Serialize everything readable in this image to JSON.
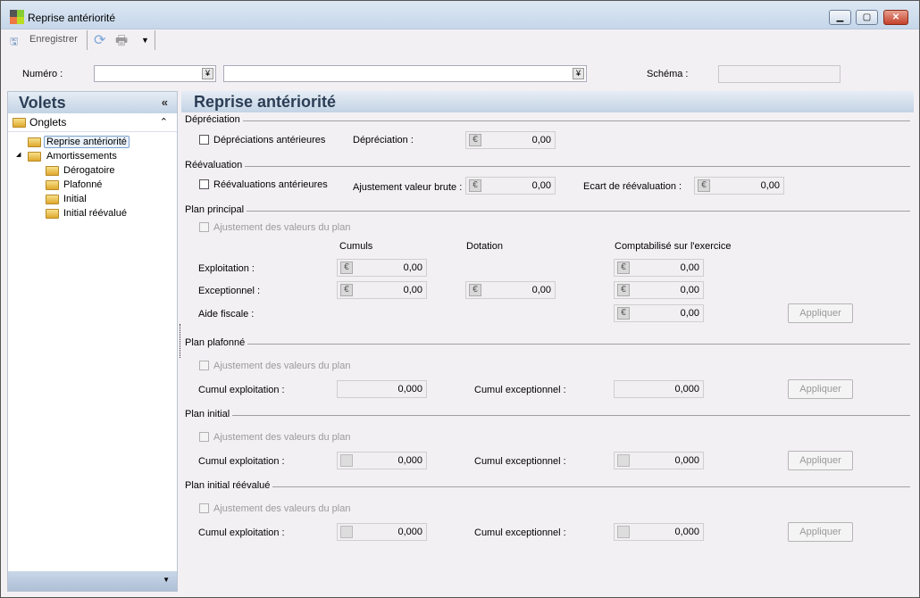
{
  "window": {
    "title": "Reprise antériorité"
  },
  "toolbar": {
    "save": "Enregistrer"
  },
  "filter": {
    "numero_label": "Numéro :",
    "numero_value": "",
    "description_value": "",
    "schema_label": "Schéma :",
    "schema_value": ""
  },
  "left": {
    "title": "Volets",
    "collapse": "«",
    "group": "Onglets",
    "group_toggle": "⌃",
    "items": [
      "Reprise antériorité",
      "Amortissements",
      "Dérogatoire",
      "Plafonné",
      "Initial",
      "Initial réévalué"
    ]
  },
  "main": {
    "title": "Reprise antériorité",
    "depreciation": {
      "section": "Dépréciation",
      "checkbox": "Dépréciations antérieures",
      "label": "Dépréciation  :",
      "value": "0,00"
    },
    "reevaluation": {
      "section": "Réévaluation",
      "checkbox": "Réévaluations antérieures",
      "adj_label": "Ajustement valeur brute :",
      "adj_value": "0,00",
      "ecart_label": "Ecart de réévaluation :",
      "ecart_value": "0,00"
    },
    "principal": {
      "section": "Plan principal",
      "checkbox": "Ajustement des valeurs du plan",
      "col_cumuls": "Cumuls",
      "col_dotation": "Dotation",
      "col_compta": "Comptabilisé sur l'exercice",
      "exploitation_label": "Exploitation :",
      "exceptionnel_label": "Exceptionnel :",
      "aide_label": "Aide fiscale :",
      "expl_cumuls": "0,00",
      "expl_compta": "0,00",
      "exc_cumuls": "0,00",
      "exc_dotation": "0,00",
      "exc_compta": "0,00",
      "aide_compta": "0,00",
      "apply": "Appliquer"
    },
    "plafonne": {
      "section": "Plan plafonné",
      "checkbox": "Ajustement des valeurs du plan",
      "cum_expl_label": "Cumul exploitation :",
      "cum_expl": "0,000",
      "cum_exc_label": "Cumul exceptionnel :",
      "cum_exc": "0,000",
      "apply": "Appliquer"
    },
    "initial": {
      "section": "Plan initial",
      "checkbox": "Ajustement des valeurs du plan",
      "cum_expl_label": "Cumul exploitation :",
      "cum_expl": "0,000",
      "cum_exc_label": "Cumul exceptionnel :",
      "cum_exc": "0,000",
      "apply": "Appliquer"
    },
    "initial_reevalue": {
      "section": "Plan initial réévalué",
      "checkbox": "Ajustement des valeurs du plan",
      "cum_expl_label": "Cumul exploitation :",
      "cum_expl": "0,000",
      "cum_exc_label": "Cumul exceptionnel :",
      "cum_exc": "0,000",
      "apply": "Appliquer"
    }
  },
  "icons": {
    "euro": "€"
  }
}
